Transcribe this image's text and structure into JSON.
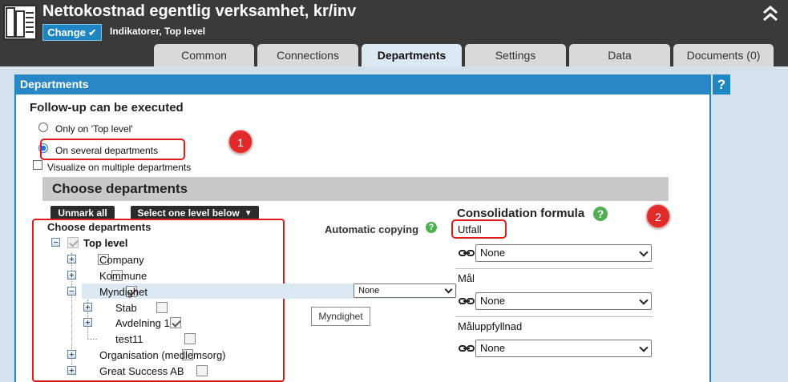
{
  "header": {
    "title": "Nettokostnad egentlig verksamhet, kr/inv",
    "change_label": "Change",
    "subtitle": "Indikatorer, Top level"
  },
  "tabs": [
    {
      "label": "Common",
      "active": false
    },
    {
      "label": "Connections",
      "active": false
    },
    {
      "label": "Departments",
      "active": true
    },
    {
      "label": "Settings",
      "active": false
    },
    {
      "label": "Data",
      "active": false
    },
    {
      "label": "Documents (0)",
      "active": false
    }
  ],
  "panel": {
    "title": "Departments",
    "help_label": "?",
    "followup_heading": "Follow-up can be executed",
    "radio_top_level": "Only on 'Top level'",
    "radio_several": "On several departments",
    "selected_radio": "several",
    "visualize_label": "Visualize on multiple departments",
    "visualize_checked": false
  },
  "annotations": {
    "badge1": "1",
    "badge2": "2"
  },
  "choose": {
    "bar_title": "Choose departments",
    "unmark_all": "Unmark all",
    "select_level": "Select one level below",
    "tree_heading": "Choose departments"
  },
  "tree": [
    {
      "label": "Top level",
      "checked": true
    },
    {
      "label": "Company",
      "checked": false
    },
    {
      "label": "Kommune",
      "checked": false
    },
    {
      "label": "Myndighet",
      "checked": true
    },
    {
      "label": "Stab",
      "checked": false
    },
    {
      "label": "Avdelning 1",
      "checked": true
    },
    {
      "label": "test11",
      "checked": false
    },
    {
      "label": "Organisation (medlemsorg)",
      "checked": false
    },
    {
      "label": "Great Success AB",
      "checked": false
    }
  ],
  "copying": {
    "label": "Automatic copying",
    "help": "?",
    "select_value": "None",
    "tooltip": "Myndighet"
  },
  "consolidation": {
    "title": "Consolidation formula",
    "help": "?",
    "rows": [
      {
        "label": "Utfall",
        "value": "None"
      },
      {
        "label": "Mål",
        "value": "None"
      },
      {
        "label": "Måluppfyllnad",
        "value": "None"
      }
    ]
  },
  "colors": {
    "header_bg": "#3a3a3a",
    "accent_blue": "#2a87c5",
    "annotation_red": "#e01b1b",
    "page_bg": "#d4e1ea"
  }
}
